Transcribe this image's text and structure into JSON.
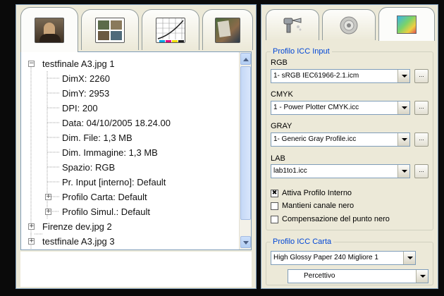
{
  "left_panel": {
    "tabs": [
      {
        "icon": "photo-icon",
        "active": true
      },
      {
        "icon": "layout-icon",
        "active": false
      },
      {
        "icon": "curves-chart-icon",
        "active": false
      },
      {
        "icon": "print-preview-icon",
        "active": false
      }
    ],
    "tree": [
      {
        "label": "testfinale A3.jpg  1",
        "expander": "minus"
      },
      {
        "label": "DimX: 2260"
      },
      {
        "label": "DimY: 2953"
      },
      {
        "label": "DPI: 200"
      },
      {
        "label": "Data: 04/10/2005 18.24.00"
      },
      {
        "label": "Dim. File: 1,3 MB"
      },
      {
        "label": "Dim. Immagine: 1,3 MB"
      },
      {
        "label": "Spazio: RGB"
      },
      {
        "label": "Pr. Input [interno]: Default"
      },
      {
        "label": "Profilo Carta: Default",
        "expander": "plus"
      },
      {
        "label": "Profilo Simul.: Default",
        "expander": "plus"
      },
      {
        "label": "Firenze dev.jpg  2",
        "expander": "plus"
      },
      {
        "label": "testfinale A3.jpg  3",
        "expander": "plus"
      }
    ]
  },
  "right_panel": {
    "tabs": [
      {
        "icon": "spray-gun-icon",
        "active": false
      },
      {
        "icon": "disc-icon",
        "active": false
      },
      {
        "icon": "color-profile-icon",
        "active": true
      }
    ],
    "input_group": {
      "legend": "Profilo ICC Input",
      "fields": [
        {
          "label": "RGB",
          "value": "1- sRGB IEC61966-2.1.icm",
          "button": "..."
        },
        {
          "label": "CMYK",
          "value": "1 - Power Plotter CMYK.icc",
          "button": "..."
        },
        {
          "label": "GRAY",
          "value": "1- Generic Gray Profile.icc",
          "button": "..."
        },
        {
          "label": "LAB",
          "value": "lab1to1.icc",
          "button": "..."
        }
      ],
      "checkboxes": [
        {
          "label": "Attiva Profilo Interno",
          "checked": true
        },
        {
          "label": "Mantieni canale nero",
          "checked": false
        },
        {
          "label": "Compensazione del punto nero",
          "checked": false
        }
      ]
    },
    "paper_group": {
      "legend": "Profilo ICC Carta",
      "paper": "High Glossy Paper 240 Migliore 1",
      "intent": "Percettivo"
    }
  }
}
